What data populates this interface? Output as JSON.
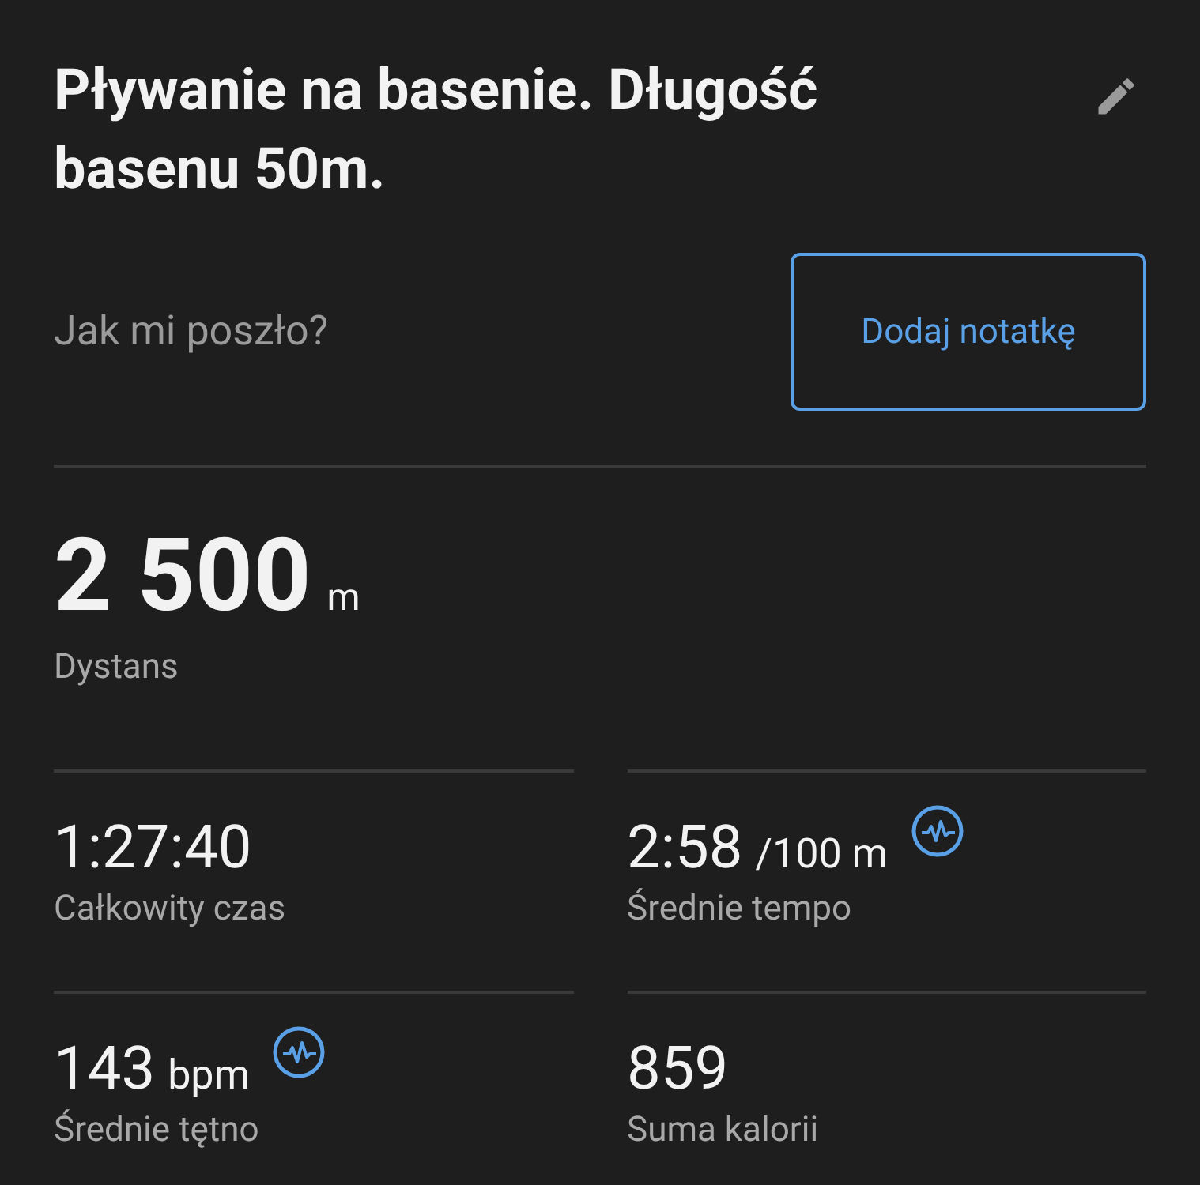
{
  "title": "Pływanie na basenie. Długość basenu 50m.",
  "feeling_label": "Jak mi poszło?",
  "note_button": "Dodaj notatkę",
  "distance": {
    "value": "2 500",
    "unit": "m",
    "label": "Dystans"
  },
  "stats": [
    {
      "value": "1:27:40",
      "label": "Całkowity czas",
      "has_chart": false
    },
    {
      "value": "2:58",
      "unit": "/100 m",
      "label": "Średnie tempo",
      "has_chart": true
    },
    {
      "value": "143",
      "unit": "bpm",
      "label": "Średnie tętno",
      "has_chart": true
    },
    {
      "value": "859",
      "label": "Suma kalorii",
      "has_chart": false
    }
  ]
}
